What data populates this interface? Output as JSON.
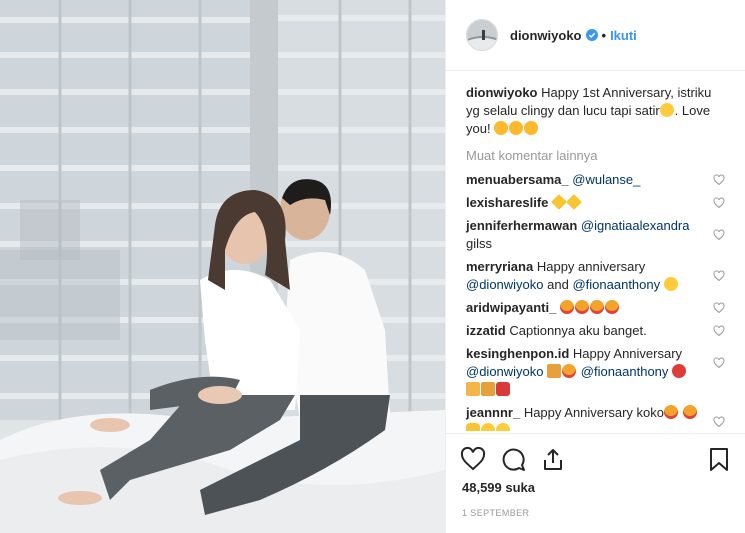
{
  "header": {
    "username": "dionwiyoko",
    "separator": "•",
    "follow_label": "Ikuti",
    "verified_color": "#3897f0"
  },
  "caption": {
    "username": "dionwiyoko",
    "text_1": "Happy 1st Anniversary, istriku yg selalu clingy dan lucu tapi satir",
    "text_2": ". Love you!",
    "emoji": [
      "grinning-sweat-face",
      "kissing-face",
      "kissing-face",
      "kissing-face"
    ]
  },
  "load_more_label": "Muat komentar lainnya",
  "comments": [
    {
      "username": "menuabersama_",
      "mention": "@wulanse_",
      "text": ""
    },
    {
      "username": "lexishareslife",
      "text": "",
      "emoji": [
        "sparkles",
        "sparkles"
      ]
    },
    {
      "username": "jenniferhermawan",
      "mention": "@ignatiaalexandra",
      "text": "gilss"
    },
    {
      "username": "merryriana",
      "text": "Happy anniversary",
      "mention": "@dionwiyoko",
      "text_2": "and",
      "mention_2": "@fionaanthony",
      "emoji": [
        "smiling-face"
      ]
    },
    {
      "username": "aridwipayanti_",
      "text": "",
      "emoji": [
        "heart-eyes",
        "heart-eyes",
        "heart-eyes",
        "heart-eyes"
      ]
    },
    {
      "username": "izzatid",
      "text": "Captionnya aku banget."
    },
    {
      "username": "kesinghenpon.id",
      "text": "Happy Anniversary",
      "mention": "@dionwiyoko",
      "mention_2": "@fionaanthony",
      "emoji": [
        "party-popper",
        "heart-eyes",
        "balloon",
        "gift",
        "party-popper",
        "dancer"
      ]
    },
    {
      "username": "jeannnr_",
      "text": "Happy Anniversary koko",
      "emoji": [
        "heart-eyes",
        "heart-eyes",
        "clapping-hands",
        "smiling-face",
        "smiling-face"
      ]
    }
  ],
  "actions": {
    "icons": [
      "heart-icon",
      "comment-icon",
      "share-icon",
      "bookmark-icon"
    ],
    "likes": "48,599 suka",
    "date": "1 September"
  }
}
